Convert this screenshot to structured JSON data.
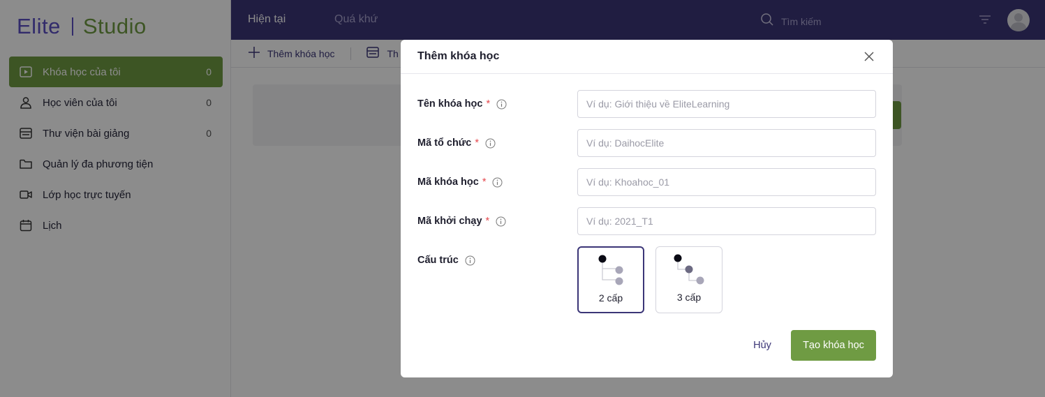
{
  "app": {
    "logo_brand": "Elite",
    "logo_product": "Studio"
  },
  "sidebar": {
    "items": [
      {
        "label": "Khóa học của tôi",
        "count": "0",
        "icon": "play-square-icon",
        "active": true
      },
      {
        "label": "Học viên của tôi",
        "count": "0",
        "icon": "user-icon",
        "active": false
      },
      {
        "label": "Thư viện bài giảng",
        "count": "0",
        "icon": "library-icon",
        "active": false
      },
      {
        "label": "Quản lý đa phương tiện",
        "count": "",
        "icon": "folder-icon",
        "active": false
      },
      {
        "label": "Lớp học trực tuyến",
        "count": "",
        "icon": "video-camera-icon",
        "active": false
      },
      {
        "label": "Lịch",
        "count": "",
        "icon": "calendar-icon",
        "active": false
      }
    ]
  },
  "header": {
    "tab_current": "Hiện tại",
    "tab_past": "Quá khứ",
    "search_placeholder": "Tìm kiếm"
  },
  "toolbar": {
    "add_course": "Thêm khóa học",
    "second_action_partial": "Th"
  },
  "modal": {
    "title": "Thêm khóa học",
    "fields": [
      {
        "label": "Tên khóa học",
        "required": "*",
        "placeholder": "Ví dụ: Giới thiệu về EliteLearning",
        "value": ""
      },
      {
        "label": "Mã tổ chức",
        "required": "*",
        "placeholder": "Ví dụ: DaihocElite",
        "value": ""
      },
      {
        "label": "Mã khóa học",
        "required": "*",
        "placeholder": "Ví dụ: Khoahoc_01",
        "value": ""
      },
      {
        "label": "Mã khởi chạy",
        "required": "*",
        "placeholder": "Ví dụ: 2021_T1",
        "value": ""
      }
    ],
    "structure": {
      "label": "Cấu trúc",
      "options": [
        {
          "label": "2 cấp",
          "selected": true
        },
        {
          "label": "3 cấp",
          "selected": false
        }
      ]
    },
    "cancel_label": "Hủy",
    "submit_label": "Tạo khóa học"
  },
  "colors": {
    "primary": "#3b3577",
    "accent_green": "#6f9b43",
    "required": "#e5484d"
  }
}
